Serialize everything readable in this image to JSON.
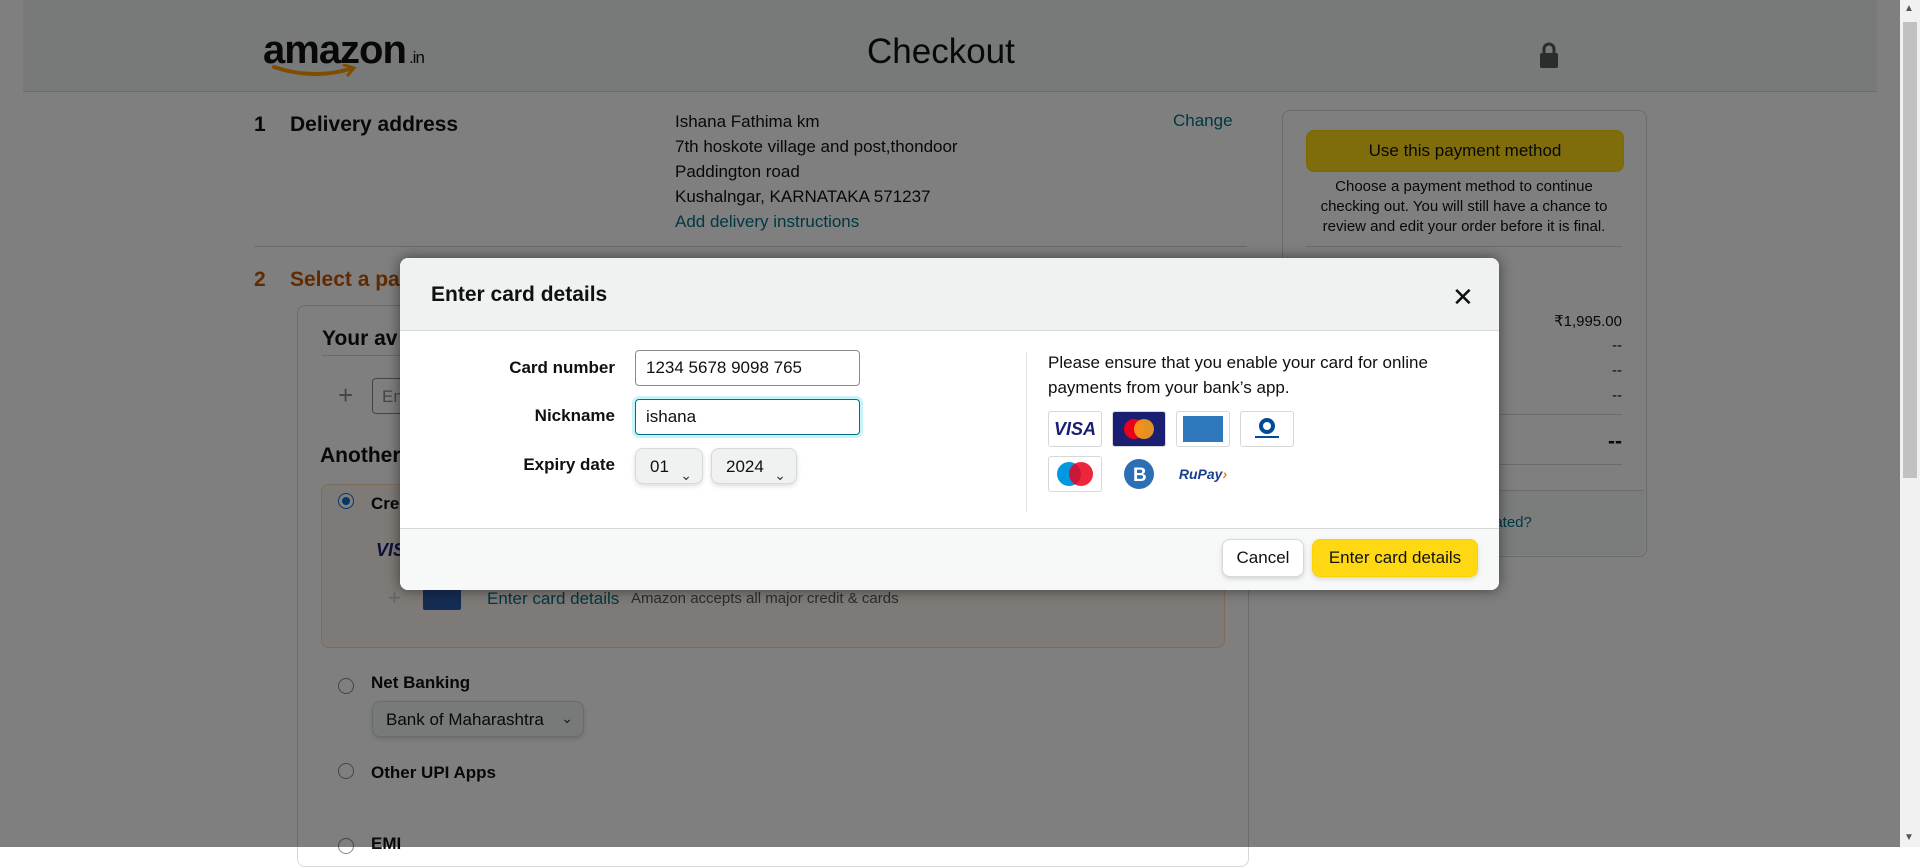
{
  "header": {
    "logo_text": "amazon",
    "logo_tld": ".in",
    "title": "Checkout"
  },
  "delivery": {
    "step": "1",
    "title": "Delivery address",
    "lines": [
      "Ishana Fathima km",
      "7th hoskote village and post,thondoor",
      "Paddington road",
      "Kushalngar, KARNATAKA 571237"
    ],
    "instructions_link": "Add delivery instructions",
    "change_link": "Change"
  },
  "payment": {
    "step": "2",
    "title_partial": "Select a pa",
    "available_partial": "Your av",
    "input_partial": "En",
    "another_partial": "Another",
    "credit_partial": "Cre",
    "visa_partial": "VIS",
    "enter_card_link": "Enter card details",
    "accepts_text": "Amazon accepts all major credit & cards",
    "net_banking_label": "Net Banking",
    "bank_selected": "Bank of Maharashtra",
    "upi_label": "Other UPI Apps",
    "emi_label": "EMI"
  },
  "summary": {
    "use_button": "Use this payment method",
    "note": "Choose a payment method to continue checking out. You will still have a chance to review and edit your order before it is final.",
    "values": [
      "₹1,995.00",
      "--",
      "--",
      "--"
    ],
    "total": "--",
    "calc_link_partial": "lated?"
  },
  "modal": {
    "title": "Enter card details",
    "close_glyph": "✕",
    "card_number_label": "Card number",
    "card_number_value": "1234 5678 9098 765",
    "nickname_label": "Nickname",
    "nickname_value": "ishana",
    "expiry_label": "Expiry date",
    "expiry_month": "01",
    "expiry_year": "2024",
    "info": "Please ensure that you enable your card for online payments from your bank’s app.",
    "card_logos": [
      {
        "name": "VISA",
        "color": "#1a1f71"
      },
      {
        "name": "MasterCard",
        "color": "#eb001b"
      },
      {
        "name": "AMERICAN EXPRESS",
        "color": "#2e77bc"
      },
      {
        "name": "Diners Club International",
        "color": "#004a97"
      },
      {
        "name": "Maestro",
        "color": "#0099df"
      },
      {
        "name": "B",
        "color": "#2c6fb4"
      },
      {
        "name": "RuPay",
        "color": "#f47920"
      }
    ],
    "cancel_button": "Cancel",
    "confirm_button": "Enter card details"
  },
  "colors": {
    "accent_yellow": "#ffd814",
    "link_teal": "#007185",
    "step_orange": "#c45500"
  }
}
